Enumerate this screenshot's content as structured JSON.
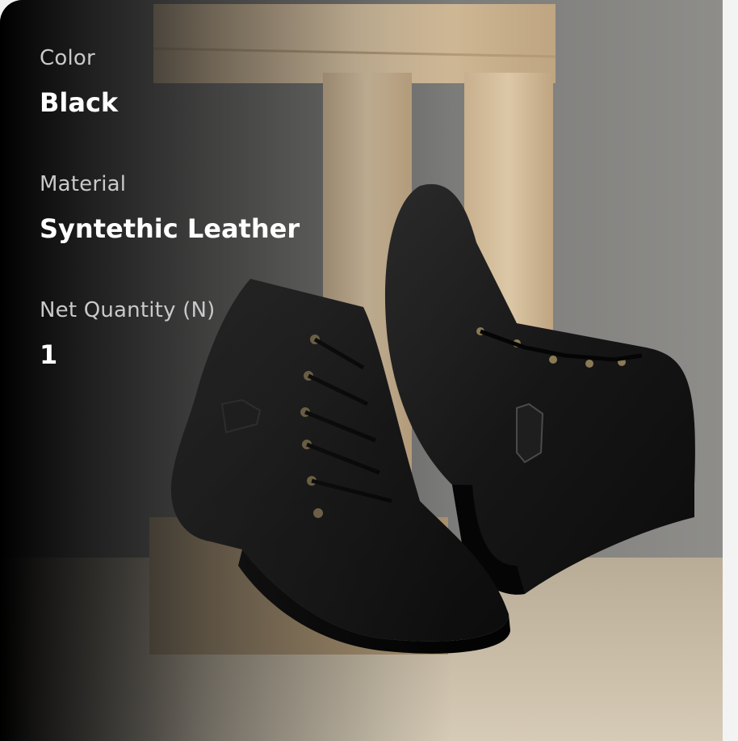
{
  "attributes": [
    {
      "label": "Color",
      "value": "Black"
    },
    {
      "label": "Material",
      "value": "Syntethic Leather"
    },
    {
      "label": "Net Quantity (N)",
      "value": "1"
    }
  ],
  "colors": {
    "label_text": "#c9c9c9",
    "value_text": "#ffffff",
    "overlay": "#000000",
    "page_background": "#f3f3f3"
  },
  "image": {
    "subject": "product-photo-black-leather-boots"
  }
}
